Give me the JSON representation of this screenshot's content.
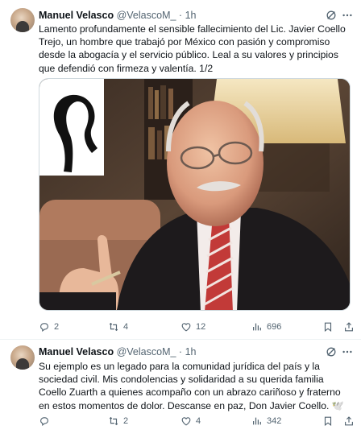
{
  "tweets": [
    {
      "name": "Manuel Velasco",
      "handle": "@VelascoM_",
      "separator": "·",
      "time": "1h",
      "text": "Lamento profundamente el sensible fallecimiento del Lic. Javier Coello Trejo, un hombre que trabajó por México con pasión y compromiso desde la abogacía y el servicio público. Leal a su valores y principios que defendió con firmeza y valentía. 1/2",
      "replies": "2",
      "reposts": "4",
      "likes": "12",
      "views": "696"
    },
    {
      "name": "Manuel Velasco",
      "handle": "@VelascoM_",
      "separator": "·",
      "time": "1h",
      "text": "Su ejemplo es un legado para la comunidad jurídica del país y la sociedad civil. Mis condolencias y solidaridad a su querida familia Coello Zuarth a quienes acompaño con un abrazo cariñoso y fraterno en estos momentos de dolor. Descanse en paz, Don Javier Coello. 🕊️",
      "replies": "",
      "reposts": "2",
      "likes": "4",
      "views": "342"
    }
  ],
  "icons": {
    "reply": "reply-icon",
    "repost": "repost-icon",
    "like": "heart-icon",
    "views": "views-icon",
    "bookmark": "bookmark-icon",
    "share": "share-icon",
    "grok": "grok-icon",
    "more": "more-icon"
  },
  "colors": {
    "secondary_text": "#536471",
    "divider": "#eff3f4"
  }
}
